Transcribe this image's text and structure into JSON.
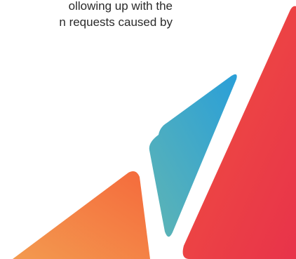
{
  "document": {
    "text_lines": [
      "ollowing up with the",
      "n requests caused by"
    ]
  },
  "graphic": {
    "shapes": [
      {
        "name": "orange-triangle",
        "color_from": "#f39a4f",
        "color_to": "#f46a3c"
      },
      {
        "name": "blue-shard",
        "color_from": "#2a9fd8",
        "color_to": "#5fb5b4"
      },
      {
        "name": "red-triangle",
        "color_from": "#f0523f",
        "color_to": "#e8334a"
      }
    ]
  }
}
